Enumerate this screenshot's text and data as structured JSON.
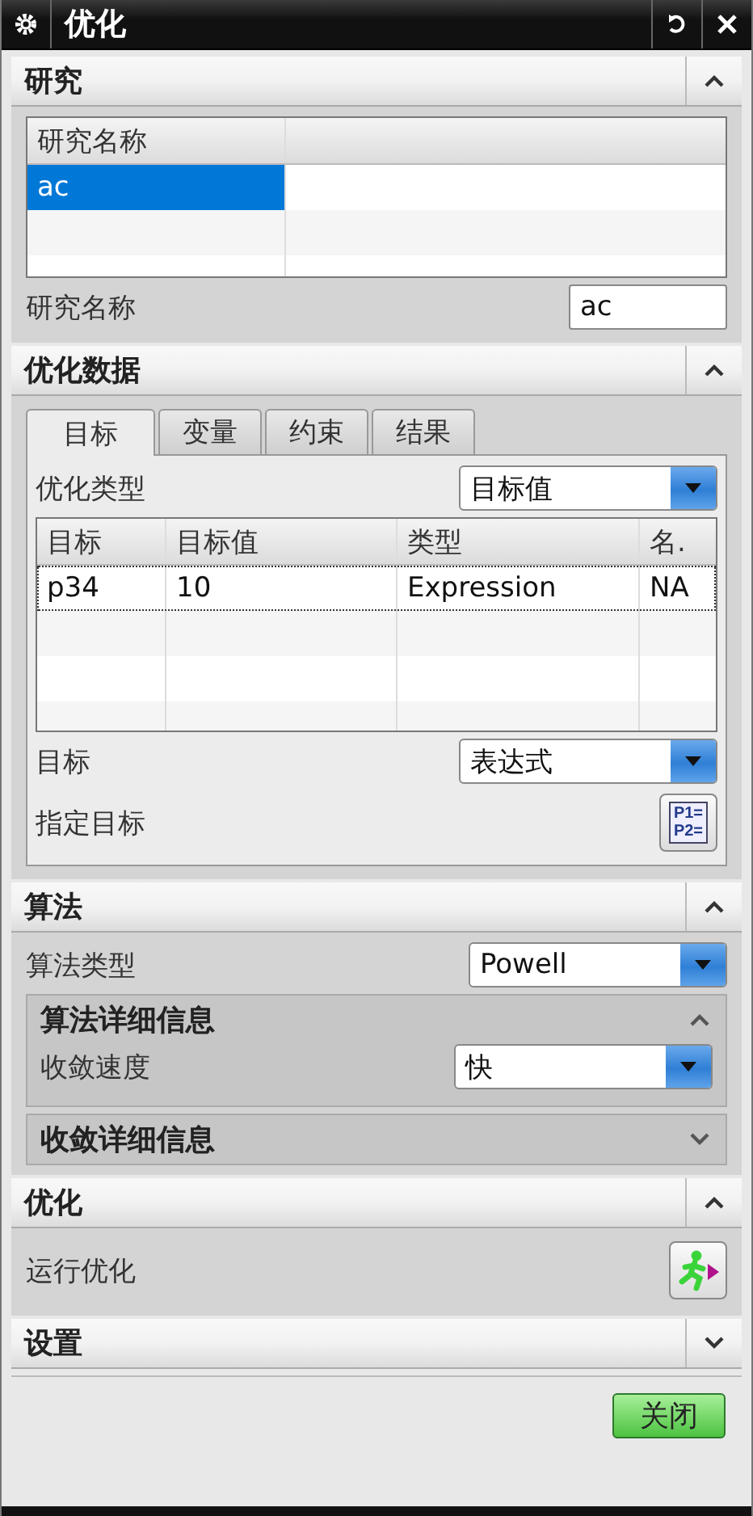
{
  "window": {
    "title": "优化"
  },
  "study": {
    "title": "研究",
    "expanded": true,
    "table": {
      "columns": [
        "研究名称"
      ],
      "rows": [
        {
          "cells": [
            "ac"
          ],
          "selected": true
        }
      ]
    },
    "name_label": "研究名称",
    "name_value": "ac"
  },
  "optimization_data": {
    "title": "优化数据",
    "expanded": true,
    "tabs": [
      {
        "label": "目标",
        "selected": true
      },
      {
        "label": "变量",
        "selected": false
      },
      {
        "label": "约束",
        "selected": false
      },
      {
        "label": "结果",
        "selected": false
      }
    ],
    "type_label": "优化类型",
    "type_value": "目标值",
    "table": {
      "columns": [
        "目标",
        "目标值",
        "类型",
        "名."
      ],
      "rows": [
        {
          "cells": [
            "p34",
            "10",
            "Expression",
            "NA"
          ],
          "focused": true
        }
      ]
    },
    "target_label": "目标",
    "target_value": "表达式",
    "specify_label": "指定目标",
    "specify_button": [
      "P1=",
      "P2="
    ]
  },
  "algorithm": {
    "title": "算法",
    "expanded": true,
    "type_label": "算法类型",
    "type_value": "Powell",
    "details": {
      "title": "算法详细信息",
      "expanded": true,
      "speed_label": "收敛速度",
      "speed_value": "快"
    },
    "convergence": {
      "title": "收敛详细信息",
      "expanded": false
    }
  },
  "optimize": {
    "title": "优化",
    "expanded": true,
    "run_label": "运行优化"
  },
  "settings": {
    "title": "设置",
    "expanded": false
  },
  "buttons": [
    {
      "label": "关闭"
    }
  ]
}
